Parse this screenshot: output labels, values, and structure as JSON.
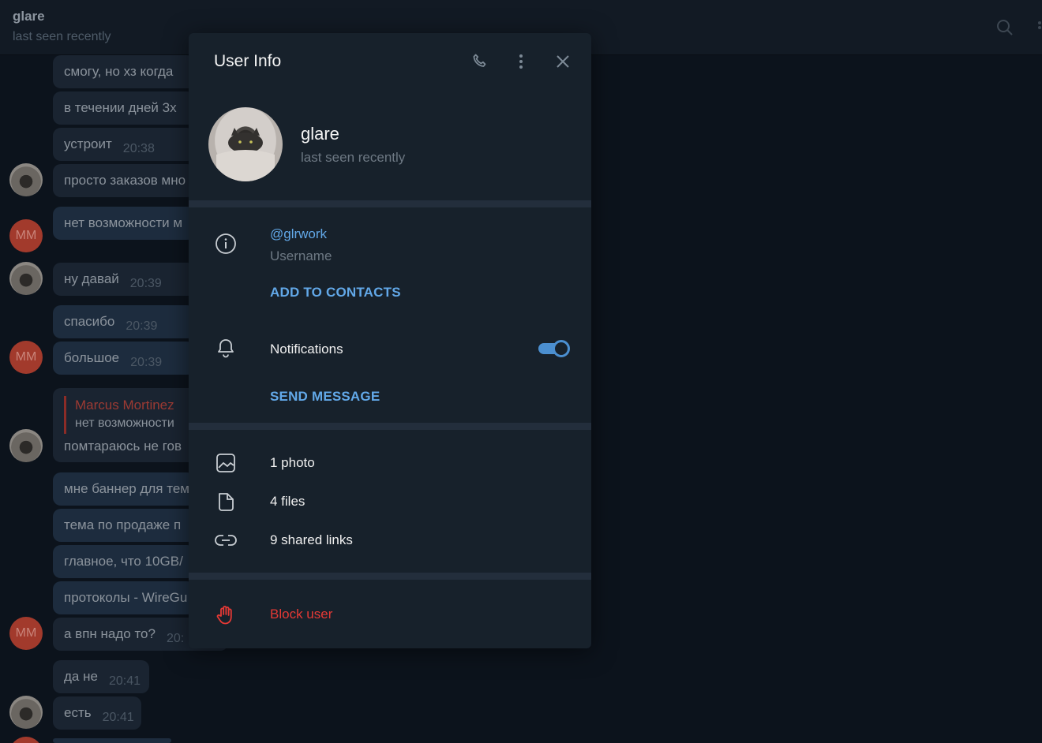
{
  "chat": {
    "title": "glare",
    "status": "last seen recently",
    "avatar_initials": "MM",
    "messages": [
      {
        "text": "смогу, но хз когда",
        "time": ""
      },
      {
        "text": "в течении дней 3х",
        "time": ""
      },
      {
        "text": "устроит",
        "time": "20:38"
      },
      {
        "text": "просто заказов мно",
        "time": ""
      },
      {
        "text": "нет возможности м",
        "time": ""
      },
      {
        "text": "ну давай",
        "time": "20:39"
      },
      {
        "text": "спасибо",
        "time": "20:39"
      },
      {
        "text": "большое",
        "time": "20:39"
      },
      {
        "text": "мне баннер для тем",
        "time": ""
      },
      {
        "text": "тема по продаже п",
        "time": ""
      },
      {
        "text": "главное, что 10GB/",
        "time": ""
      },
      {
        "text": "протоколы - WireGu",
        "time": ""
      },
      {
        "text": "а впн надо то?",
        "time": "20:"
      },
      {
        "text": "да не",
        "time": "20:41"
      },
      {
        "text": "есть",
        "time": "20:41"
      }
    ],
    "reply": {
      "name": "Marcus Mortinez",
      "quote": "нет возможности",
      "text": "помтараюсь не гов"
    }
  },
  "modal": {
    "title": "User Info",
    "profile": {
      "name": "glare",
      "status": "last seen recently"
    },
    "info": {
      "username": "@glrwork",
      "username_label": "Username",
      "add_to_contacts": "ADD TO CONTACTS",
      "notifications_label": "Notifications",
      "notifications_enabled": true,
      "send_message": "SEND MESSAGE"
    },
    "media": {
      "photos": "1 photo",
      "files": "4 files",
      "links": "9 shared links"
    },
    "block_user": "Block user"
  },
  "colors": {
    "accent": "#62a8e8",
    "danger": "#e53935",
    "panel": "#17212b"
  }
}
